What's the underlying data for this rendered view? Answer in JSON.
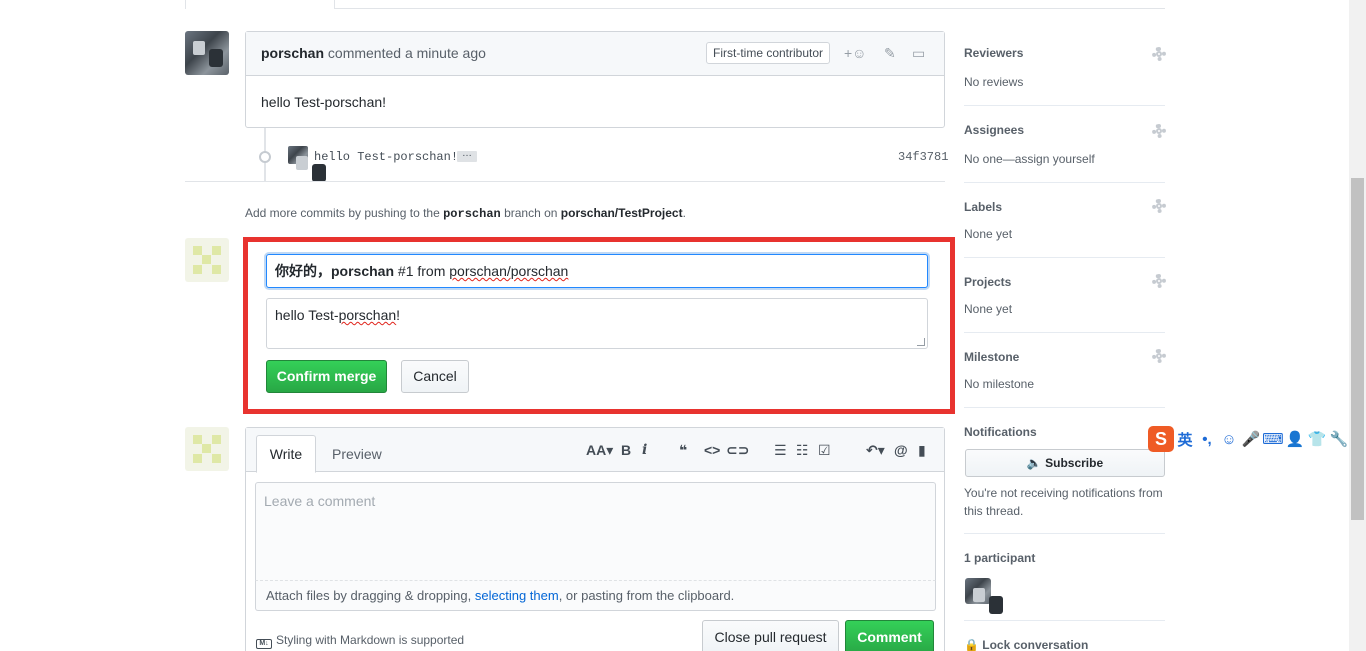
{
  "comment": {
    "author": "porschan",
    "meta": "commented a minute ago",
    "badge": "First-time contributor",
    "body": "hello Test-porschan!",
    "icons": [
      "add-reaction-icon",
      "pencil-icon",
      "report-icon"
    ]
  },
  "commit": {
    "message": "hello Test-porschan!",
    "ellipsis": "…",
    "sha": "34f3781"
  },
  "push_note": {
    "prefix": "Add more commits by pushing to the",
    "branch": "porschan",
    "middle": "branch on",
    "repo": "porschan/TestProject",
    "suffix": "."
  },
  "merge": {
    "title_a": "你好的，porschan",
    "title_b": "#1 from",
    "title_c": "porschan/porschan",
    "body_a": "hello Test-",
    "body_b": "porschan",
    "body_c": "!",
    "confirm_label": "Confirm merge",
    "cancel_label": "Cancel",
    "highlight_color": "#e8332f"
  },
  "new_comment": {
    "tab_write": "Write",
    "tab_preview": "Preview",
    "toolbar": {
      "heading": "AA▾",
      "bold": "B",
      "italic": "i",
      "quote": "❝",
      "code": "<>",
      "link": "⊂⊃",
      "ul": "☰",
      "ol": "☷",
      "task": "☑",
      "reply": "↶▾",
      "mention": "@",
      "saved": "▮"
    },
    "placeholder": "Leave a comment",
    "attach_a": "Attach files by dragging & dropping,",
    "attach_link": "selecting them",
    "attach_b": ", or pasting from the clipboard.",
    "markdown_note": "Styling with Markdown is supported",
    "md_badge": "M↓",
    "close_label": "Close pull request",
    "comment_label": "Comment"
  },
  "sidebar": {
    "reviewers_title": "Reviewers",
    "reviewers_value": "No reviews",
    "assignees_title": "Assignees",
    "assignees_value": "No one—assign yourself",
    "labels_title": "Labels",
    "labels_value": "None yet",
    "projects_title": "Projects",
    "projects_value": "None yet",
    "milestone_title": "Milestone",
    "milestone_value": "No milestone",
    "notifications_title": "Notifications",
    "subscribe_label": "🔈 Subscribe",
    "notifications_note": "You're not receiving notifications from this thread.",
    "participants_title": "1 participant",
    "lock_label": "🔒 Lock conversation"
  },
  "ime": {
    "logo": "S",
    "items": [
      "英",
      "•,",
      "☺",
      "🎤",
      "⌨",
      "👤",
      "👕",
      "🔧"
    ]
  }
}
